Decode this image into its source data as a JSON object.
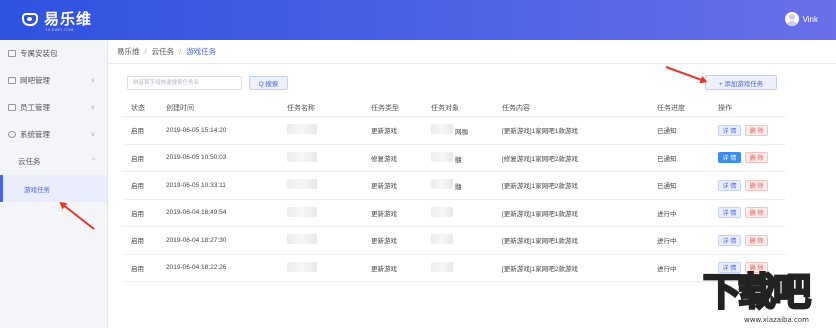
{
  "header": {
    "logo_text": "易乐维",
    "logo_sub": "YILEWEI.COM",
    "username": "Vink"
  },
  "sidebar": {
    "items": [
      {
        "label": "专属安装包",
        "has_chevron": false
      },
      {
        "label": "网吧管理",
        "has_chevron": true
      },
      {
        "label": "员工管理",
        "has_chevron": true
      },
      {
        "label": "系统管理",
        "has_chevron": true
      }
    ],
    "cloud_task": {
      "label": "云任务",
      "chevron": "^"
    },
    "active_item": {
      "label": "游戏任务"
    }
  },
  "breadcrumb": {
    "root": "易乐维",
    "sep1": "/",
    "mid": "云任务",
    "sep2": "/",
    "current": "游戏任务"
  },
  "search": {
    "placeholder": "拼音首字母快速搜索任务名",
    "button_label": "Q 搜索"
  },
  "toolbar": {
    "add_label": "+ 添加游戏任务"
  },
  "table": {
    "columns": [
      "状态",
      "创建时间",
      "任务名称",
      "任务类型",
      "任务对象",
      "任务内容",
      "任务进度",
      "操作"
    ],
    "rows": [
      {
        "status": "启用",
        "time": "2019-06-05 15:14:20",
        "type": "更新游戏",
        "target_suffix": "网咖",
        "content": "[更新游戏]1家网吧1款游戏",
        "progress": "已通知",
        "detail": "详 情",
        "delete": "删 除",
        "detail_active": false
      },
      {
        "status": "启用",
        "time": "2019-06-05 10:50:03",
        "type": "修复游戏",
        "target_suffix": "髓",
        "content": "[修复游戏]1家网吧2款游戏",
        "progress": "已通知",
        "detail": "详 情",
        "delete": "删 除",
        "detail_active": true
      },
      {
        "status": "启用",
        "time": "2019-06-05 10:33:11",
        "type": "更新游戏",
        "target_suffix": "髓",
        "content": "[更新游戏]1家网吧2款游戏",
        "progress": "已通知",
        "detail": "详 情",
        "delete": "删 除",
        "detail_active": false
      },
      {
        "status": "启用",
        "time": "2019-06-04 18:49:54",
        "type": "更新游戏",
        "target_suffix": "",
        "content": "[更新游戏]1家网吧1款游戏",
        "progress": "进行中",
        "detail": "详 情",
        "delete": "删 除",
        "detail_active": false
      },
      {
        "status": "启用",
        "time": "2019-06-04 18:27:30",
        "type": "更新游戏",
        "target_suffix": "",
        "content": "[更新游戏]1家网吧1款游戏",
        "progress": "进行中",
        "detail": "详 情",
        "delete": "删 除",
        "detail_active": false
      },
      {
        "status": "启用",
        "time": "2019-06-04 18:22:26",
        "type": "更新游戏",
        "target_suffix": "",
        "content": "[更新游戏]1家网吧2款游戏",
        "progress": "进行中",
        "detail": "详 情",
        "delete": "删 除",
        "detail_active": false
      }
    ]
  },
  "watermark": {
    "main": "下载吧",
    "url": "www.xiazaiba.com"
  },
  "colors": {
    "accent": "#4a63e7",
    "header_start": "#2f52e0",
    "header_end": "#6b6fe8",
    "arrow": "#e8342c",
    "delete": "#e05555"
  }
}
